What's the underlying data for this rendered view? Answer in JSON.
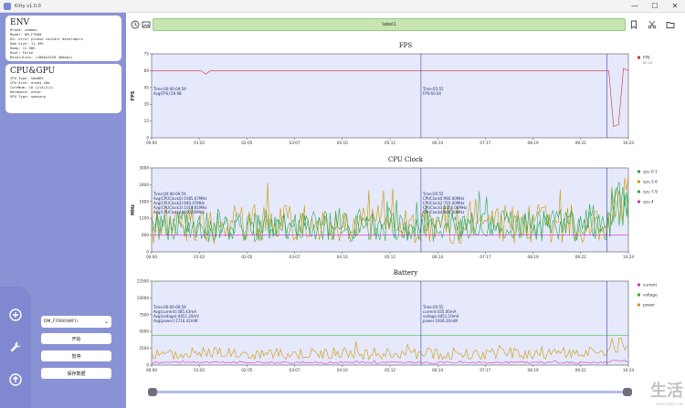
{
  "window": {
    "title": "Kitty v1.0.0",
    "min": "—",
    "max": "☐",
    "close": "✕"
  },
  "env": {
    "title": "ENV",
    "lines": [
      "Brand: common",
      "Model: DM_F7060",
      "OS: error please contact developers",
      "Ram size: 11.49G",
      "Romp: 11.58G",
      "Root: False",
      "Resolution: (1080x2520 400dpi)"
    ]
  },
  "cpu": {
    "title": "CPU&GPU",
    "lines": [
      "CPU Type: sdm865",
      "CPU Arch: arm64_v8a",
      "CoreNum: 10 (2+5+2+1)",
      "Hardware: other",
      "GPU Type: samsung"
    ]
  },
  "sidebar_icons": [
    "plus-circle-icon",
    "wrench-icon",
    "upload-icon"
  ],
  "device_select": {
    "value": "DM_F7060(WIFI)"
  },
  "buttons": {
    "start": "开始",
    "pause": "暂停",
    "save": "保存数据"
  },
  "toolbar": {
    "label": "label1"
  },
  "watermark": {
    "main": "生活",
    "sub": "www.3elife.net"
  },
  "colors": {
    "plot_bg": "#e6e8fb",
    "fps": "#cc3333",
    "cpu0": "#22aa44",
    "cpu1": "#cc9900",
    "cpu2": "#33aa55",
    "cpu3": "#cc33cc",
    "current": "#cc33cc",
    "voltage": "#22bb22",
    "power": "#cc9900"
  },
  "chart_data": [
    {
      "type": "line",
      "title": "FPS",
      "ylabel": "FPS",
      "ylim": [
        0,
        75
      ],
      "yticks": [
        0,
        15,
        30,
        45,
        60,
        75
      ],
      "xticks": [
        "00:00",
        "01:02",
        "02:05",
        "03:07",
        "04:10",
        "05:12",
        "06:14",
        "07:17",
        "08:19",
        "09:22",
        "10:24"
      ],
      "series": [
        {
          "name": "FPS",
          "values": [
            59.98,
            60,
            60,
            60,
            60,
            60,
            60,
            60,
            60,
            60,
            60,
            57,
            60,
            60,
            60,
            60,
            60,
            60,
            60,
            60,
            60,
            60,
            60,
            60,
            60,
            60,
            60,
            60,
            60,
            60,
            60,
            60,
            60,
            60,
            60,
            60,
            60,
            60,
            60,
            60,
            60,
            60,
            60,
            60,
            60,
            60,
            60,
            60,
            60,
            60,
            60,
            60,
            60,
            60,
            60,
            60,
            60,
            60,
            60,
            60,
            60,
            60,
            60,
            60,
            60,
            60,
            60,
            60,
            60,
            60,
            60,
            60,
            60,
            60,
            60,
            60,
            60,
            60,
            60,
            60,
            60,
            60,
            60,
            60,
            60,
            60,
            60,
            60,
            60,
            60,
            60,
            60,
            60,
            60,
            10,
            12,
            62,
            60
          ]
        }
      ],
      "legend": [
        {
          "name": "FPS",
          "sub": "60.04"
        }
      ],
      "annotations": [
        {
          "lines": [
            "Time:00:00-09:59",
            "Avg(FPS):59.98"
          ]
        },
        {
          "lines": [
            "Time:05:55",
            "FPS:60.04"
          ]
        }
      ]
    },
    {
      "type": "line",
      "title": "CPU Clock",
      "ylabel": "MHz",
      "ylim": [
        0,
        3000
      ],
      "yticks": [
        0,
        600,
        1200,
        1800,
        2400,
        3000
      ],
      "xticks": [
        "00:00",
        "01:02",
        "02:05",
        "03:07",
        "04:10",
        "05:12",
        "06:14",
        "07:17",
        "08:19",
        "09:22",
        "10:24"
      ],
      "series": [
        {
          "name": "cpu 0-1",
          "base": 900,
          "amp": 500
        },
        {
          "name": "cpu 2-6",
          "base": 1000,
          "amp": 700
        },
        {
          "name": "cpu 7-9",
          "base": 950,
          "amp": 600
        },
        {
          "name": "cpu 4",
          "base": 600,
          "amp": 0
        }
      ],
      "legend": [
        {
          "name": "cpu 0-1"
        },
        {
          "name": "cpu 2-6"
        },
        {
          "name": "cpu 7-9"
        },
        {
          "name": "cpu 4"
        }
      ],
      "annotations": [
        {
          "lines": [
            "Time:00:00-09:59",
            "Avg(CPUClock0):1085.67MHz",
            "Avg(CPUClock2):940.47MHz",
            "Avg(CPUClock3):1019.81MHz",
            "Avg(CPUClock4):600.00MHz"
          ]
        },
        {
          "lines": [
            "Time:05:55",
            "CPUClock0:960.00MHz",
            "CPUClock2:710.40MHz",
            "CPUClock3:1056.00MHz",
            "CPUClock4:600.00MHz"
          ]
        }
      ]
    },
    {
      "type": "line",
      "title": "Battery",
      "ylabel": "",
      "ylim": [
        0,
        12500
      ],
      "yticks": [
        0,
        2500,
        5000,
        7500,
        10000,
        12500
      ],
      "xticks": [
        "00:00",
        "01:02",
        "02:05",
        "03:07",
        "04:10",
        "05:12",
        "06:14",
        "07:17",
        "08:19",
        "09:22",
        "10:24"
      ],
      "series": [
        {
          "name": "current",
          "base": 385,
          "amp": 150
        },
        {
          "name": "voltage",
          "base": 4451,
          "amp": 0
        },
        {
          "name": "power",
          "base": 1716,
          "amp": 900
        }
      ],
      "legend": [
        {
          "name": "current"
        },
        {
          "name": "voltage"
        },
        {
          "name": "power"
        }
      ],
      "annotations": [
        {
          "lines": [
            "Time:00:00-09:59",
            "Avg(current):385.43mA",
            "Avg(voltage):4451.20mV",
            "Avg(power):1716.42mW"
          ]
        },
        {
          "lines": [
            "Time:05:55",
            "current:435.00mA",
            "voltage:4451.10mV",
            "power:1936.10mW"
          ]
        }
      ]
    }
  ],
  "timeline": {
    "start": 0,
    "end": 1
  }
}
